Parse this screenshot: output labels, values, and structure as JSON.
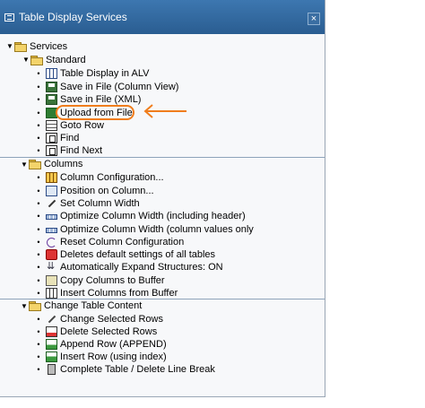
{
  "window": {
    "title": "Table Display Services",
    "close_glyph": "×"
  },
  "root": {
    "label": "Services"
  },
  "standard": {
    "label": "Standard",
    "items": [
      {
        "label": "Table Display in ALV",
        "icon": "table-icon"
      },
      {
        "label": "Save in File (Column View)",
        "icon": "save-icon"
      },
      {
        "label": "Save in File (XML)",
        "icon": "save-xml-icon"
      },
      {
        "label": "Upload from File",
        "icon": "upload-icon"
      },
      {
        "label": "Goto Row",
        "icon": "goto-row-icon"
      },
      {
        "label": "Find",
        "icon": "find-icon"
      },
      {
        "label": "Find Next",
        "icon": "find-next-icon"
      }
    ]
  },
  "columns": {
    "label": "Columns",
    "items": [
      {
        "label": "Column Configuration...",
        "icon": "column-config-icon"
      },
      {
        "label": "Position on Column...",
        "icon": "position-icon"
      },
      {
        "label": "Set Column Width",
        "icon": "pencil-icon"
      },
      {
        "label": "Optimize Column Width (including header)",
        "icon": "optimize-width-icon"
      },
      {
        "label": "Optimize Column Width (column values only",
        "icon": "optimize-width-values-icon"
      },
      {
        "label": "Reset Column Configuration",
        "icon": "reset-icon"
      },
      {
        "label": "Deletes default settings of all tables",
        "icon": "delete-settings-icon"
      },
      {
        "label": "Automatically Expand Structures: ON",
        "icon": "expand-icon"
      },
      {
        "label": "Copy Columns to Buffer",
        "icon": "copy-icon"
      },
      {
        "label": "Insert Columns from Buffer",
        "icon": "insert-columns-icon"
      }
    ]
  },
  "change": {
    "label": "Change Table Content",
    "items": [
      {
        "label": "Change Selected Rows",
        "icon": "pencil-icon"
      },
      {
        "label": "Delete Selected Rows",
        "icon": "delete-row-icon"
      },
      {
        "label": "Append Row (APPEND)",
        "icon": "append-row-icon"
      },
      {
        "label": "Insert Row (using index)",
        "icon": "insert-row-icon"
      },
      {
        "label": "Complete Table / Delete Line Break",
        "icon": "trash-icon"
      }
    ]
  },
  "annotation": {
    "color": "#f07d1c",
    "target": "Upload from File"
  }
}
